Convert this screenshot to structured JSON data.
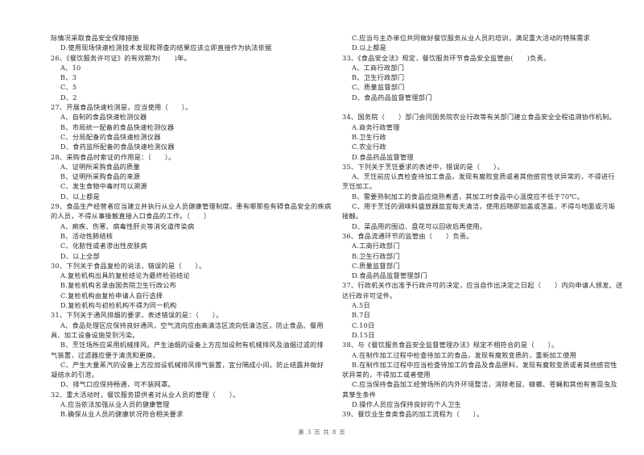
{
  "left_column": [
    {
      "carryover": [
        "际情况采取食品安全保障措施"
      ],
      "options": [
        [
          "D.使用现场快速检测技术发现和筛查的结果应该立即直接作为执法依据"
        ]
      ]
    },
    {
      "num": "26",
      "stem": [
        "26、《餐饮服务许可证》的有效期为(　　)年。"
      ],
      "options": [
        [
          "A、10"
        ],
        [
          "B、3"
        ],
        [
          "C、5"
        ],
        [
          "D、2"
        ]
      ]
    },
    {
      "num": "27",
      "stem": [
        "27、开展食品快速检测是，应当使用（　　）。"
      ],
      "options": [
        [
          "A、自制的食品快速检测仪器"
        ],
        [
          "B、市局统一配备的食品快速检测仪器"
        ],
        [
          "C、分局配备的食品快速检测仪器"
        ],
        [
          "D、食药监所配备的食品快速检测仪器"
        ]
      ]
    },
    {
      "num": "28",
      "stem": [
        "28、采购食品时索证的作用是：（　　）。"
      ],
      "options": [
        [
          "A、证明所采购食品的质量"
        ],
        [
          "B、证明所采购食品的来源"
        ],
        [
          "C、发生食物中毒时可以溯源"
        ],
        [
          "D、以上都是"
        ]
      ]
    },
    {
      "num": "29",
      "stem": [
        "29、食品生产经营者应当建立并执行从业人员健康管理制度。患有哪那些有碍食品安全的疾病",
        "的人员，不得从事接触直接入口食品的工作。（　　）"
      ],
      "options": [
        [
          "A、痢疾、伤寒、病毒性肝炎等消化道传染病"
        ],
        [
          "B、活动性肺结核"
        ],
        [
          "C、化脓性或者渗出性皮肤病"
        ],
        [
          "D、以上全部"
        ]
      ]
    },
    {
      "num": "30",
      "stem": [
        "30、下列关于食品复检的说法，错误的是（　　）。"
      ],
      "options": [
        [
          "A.复检机构出具的复检结论为最终检验结论"
        ],
        [
          "B.复检机构名录由国务院卫生行政公布"
        ],
        [
          "C.复检机构由复检申请人自行选择"
        ],
        [
          "D.复检机构与初检机构不得为同一机构"
        ]
      ]
    },
    {
      "num": "31",
      "stem": [
        "31、下列关于通风排烟的要求，表述错误的是：（　　）。"
      ],
      "options": [
        [
          "A、食品处理区应保持良好通风，空气流向应由高清洁区流向低清洁区，防止食品、餐用",
          "具、加工设备设施受到污染。"
        ],
        [
          "B、烹饪场所应采用机械排风。产生油烟的设备上方应加设附有机械排风及油烟过滤的排",
          "气装置，过滤器应便于清洗和更换。"
        ],
        [
          "C、产生大量蒸汽的设备上方应加设机械排风排气装置，宜分隔成小间，防止结露并做好",
          "凝结水的引泄。"
        ],
        [
          "D、排气口应保持畅通，可不装网罩。"
        ]
      ]
    },
    {
      "num": "32",
      "stem": [
        "32、重大活动时，餐饮服务提供者对从业人员的管理（　　）。"
      ],
      "options": [
        [
          "A.应当依法加强从业人员的健康管理"
        ],
        [
          "B.确保从业人员的健康状况符合相关要求"
        ]
      ]
    }
  ],
  "right_column": [
    {
      "options": [
        [
          "C.应当与主办单位共同做好餐饮服务从业人员的培训，满足重大活动的特殊需求"
        ],
        [
          "D.以上都是"
        ]
      ]
    },
    {
      "num": "33",
      "stem": [
        "33、《食品安全法》规定，餐饮服务环节食品安全监管由(　　)负责。"
      ],
      "options": [
        [
          "A、工商行政部门"
        ],
        [
          "B、卫生行政部门"
        ],
        [
          "C、质量监督部门"
        ],
        [
          "D、食品药品监督管理部门"
        ]
      ]
    },
    {
      "num": "34",
      "stem": [
        "34、国务院（　　）部门会同国务院农业行政等有关部门建立食品安全全程追溯协作机制。"
      ],
      "options": [
        [
          "A.商务行政管理"
        ],
        [
          "B.卫生行政"
        ],
        [
          "C.农业行政"
        ],
        [
          "D.食品药品监督管理"
        ]
      ]
    },
    {
      "num": "35",
      "stem": [
        "35、下列关于烹饪要求的表述中，错误的是（　　）。"
      ],
      "options": [
        [
          "A、烹饪前应认真检查待加工食品，发现有腐败变质或者其他感官性状异常的，不得进行",
          "烹饪加工。"
        ],
        [
          "B、需要熟制加工的食品应烧熟煮透，其加工时食品中心温度应不低于70℃。"
        ],
        [
          "C、用于烹饪的调味料盛放器皿宜每天清洁，使用后随即加盖或苫盖，不得与地面或污垢",
          "接触。"
        ],
        [
          "D、菜品用的围边、盘花可以回收后再使用。"
        ]
      ]
    },
    {
      "num": "36",
      "stem": [
        "36、食品流通环节的监管由（　　）负责。"
      ],
      "options": [
        [
          "A.工商行政部门"
        ],
        [
          "B.卫生行政部门"
        ],
        [
          "C.质量监督部门"
        ],
        [
          "D.食品药品监督管理部门"
        ]
      ]
    },
    {
      "num": "37",
      "stem": [
        "37、行政机关作出准予行政许可的决定，应当自作出决定之日起（　　）内向申请人颁发、送",
        "达行政许可证件。"
      ],
      "options": [
        [
          "A.5日"
        ],
        [
          "B.7日"
        ],
        [
          "C.10日"
        ],
        [
          "D.15日"
        ]
      ]
    },
    {
      "num": "38",
      "stem": [
        "38、与《餐饮服务食品安全监督管理办法》规定不相符合的是（　　）。"
      ],
      "options": [
        [
          "A.在制作加工过程中检查待加工的食品，发现有腐败变质的，重新加工使用"
        ],
        [
          "B.在制作加工过程中应当检查待加工的食品及食品原料，发现有腐败变质或者其他感官性",
          "状异常的，不得加工或者使用"
        ],
        [
          "C.应当保持食品加工经营场所的内外环境整洁，消除老鼠、蟑螂、苍蝇和其他有害昆虫及",
          "其孳生条件"
        ],
        [
          "D.操作人员应当保持良好的个人卫生"
        ]
      ]
    },
    {
      "num": "39",
      "stem": [
        "39、餐饮业生食类食品的加工流程为（　　）。"
      ],
      "options": []
    }
  ],
  "footer": {
    "page_label": "第 3 页 共 8 页"
  }
}
